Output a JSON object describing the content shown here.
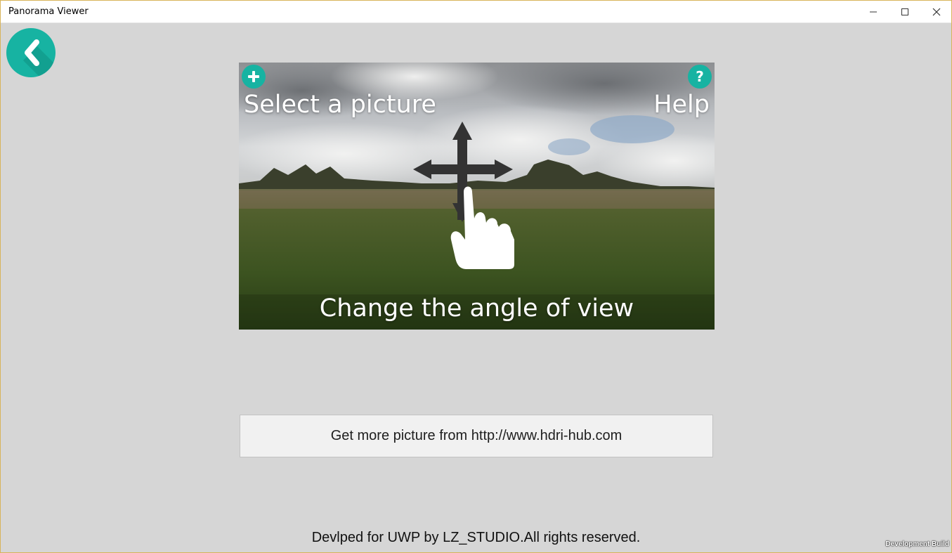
{
  "window": {
    "title": "Panorama Viewer",
    "controls": {
      "minimize_icon": "minimize-icon",
      "maximize_icon": "maximize-icon",
      "close_icon": "close-icon"
    }
  },
  "colors": {
    "accent": "#17b3a2",
    "background": "#d6d6d6",
    "button_bg": "#f1f1f1"
  },
  "nav": {
    "back_icon": "chevron-left-icon"
  },
  "panorama": {
    "select_label": "Select a picture",
    "select_icon": "plus-circle-icon",
    "help_label": "Help",
    "help_icon": "question-circle-icon",
    "help_glyph": "?",
    "gesture_caption": "Change the angle of view",
    "gesture_icons": [
      "four-way-arrow-icon",
      "hand-pointer-icon"
    ]
  },
  "more_button": {
    "label": "Get more picture from http://www.hdri-hub.com"
  },
  "footer": {
    "text": "Devlped for UWP by LZ_STUDIO.All rights reserved."
  },
  "watermark": {
    "text": "Development Build"
  }
}
